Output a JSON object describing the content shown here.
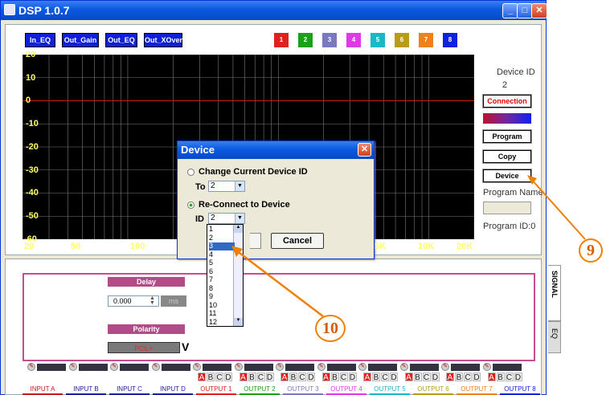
{
  "window": {
    "title": "DSP 1.0.7",
    "min": "_",
    "max": "□",
    "close": "✕"
  },
  "toolbar": {
    "in_eq": "In_EQ",
    "out_gain": "Out_Gain",
    "out_eq": "Out_EQ",
    "out_xover": "Out_XOver",
    "channels": [
      {
        "label": "1",
        "color": "#e0201c"
      },
      {
        "label": "2",
        "color": "#1ca01c"
      },
      {
        "label": "3",
        "color": "#7a78c0"
      },
      {
        "label": "4",
        "color": "#e038e8"
      },
      {
        "label": "5",
        "color": "#18b8c8"
      },
      {
        "label": "6",
        "color": "#b89c18"
      },
      {
        "label": "7",
        "color": "#f08018"
      },
      {
        "label": "8",
        "color": "#1020e0"
      }
    ]
  },
  "chart_data": {
    "type": "line",
    "ylim": [
      -60,
      20
    ],
    "yticks": [
      "20",
      "10",
      "0",
      "-10",
      "-20",
      "-30",
      "-40",
      "-50",
      "-60"
    ],
    "xticks": [
      "20",
      "50",
      "100",
      "5K",
      "10K",
      "20K"
    ],
    "series": [
      {
        "values": [
          0,
          0
        ]
      }
    ]
  },
  "side": {
    "device_id_label": "Device ID",
    "device_id_value": "2",
    "connection": "Connection",
    "program": "Program",
    "copy": "Copy",
    "device": "Device",
    "program_name_label": "Program Name",
    "program_id": "Program ID:0"
  },
  "lower": {
    "delay_label": "Delay",
    "delay_value": "0.000",
    "delay_unit": "ms",
    "polarity_label": "Polarity",
    "polarity_value": "POL+",
    "polarity_arrow": "V",
    "tab_signal": "SIGNAL",
    "tab_eq": "EQ",
    "abcd": [
      "A",
      "B",
      "C",
      "D"
    ],
    "tabs": [
      {
        "label": "INPUT A",
        "color": "#c01c1c"
      },
      {
        "label": "INPUT B",
        "color": "#1c1c9c"
      },
      {
        "label": "INPUT C",
        "color": "#1c1c9c"
      },
      {
        "label": "INPUT D",
        "color": "#1c1c9c"
      },
      {
        "label": "OUTPUT 1",
        "color": "#e0201c"
      },
      {
        "label": "OUTPUT 2",
        "color": "#1ca01c"
      },
      {
        "label": "OUTPUT 3",
        "color": "#7a78c0"
      },
      {
        "label": "OUTPUT 4",
        "color": "#e038e8"
      },
      {
        "label": "OUTPUT 5",
        "color": "#18b8c8"
      },
      {
        "label": "OUTPUT 6",
        "color": "#b89c18"
      },
      {
        "label": "OUTPUT 7",
        "color": "#f08018"
      },
      {
        "label": "OUTPUT 8",
        "color": "#1020e0"
      }
    ]
  },
  "dialog": {
    "title": "Device",
    "change_label": "Change Current Device ID",
    "to_label": "To",
    "to_value": "2",
    "reconnect_label": "Re-Connect to Device",
    "id_label": "ID",
    "id_value": "2",
    "ok_label": "",
    "cancel_label": "Cancel",
    "options": [
      "1",
      "2",
      "3",
      "4",
      "5",
      "6",
      "7",
      "8",
      "9",
      "10",
      "11",
      "12"
    ],
    "selected": "3"
  },
  "markers": {
    "nine": "9",
    "ten": "10"
  }
}
